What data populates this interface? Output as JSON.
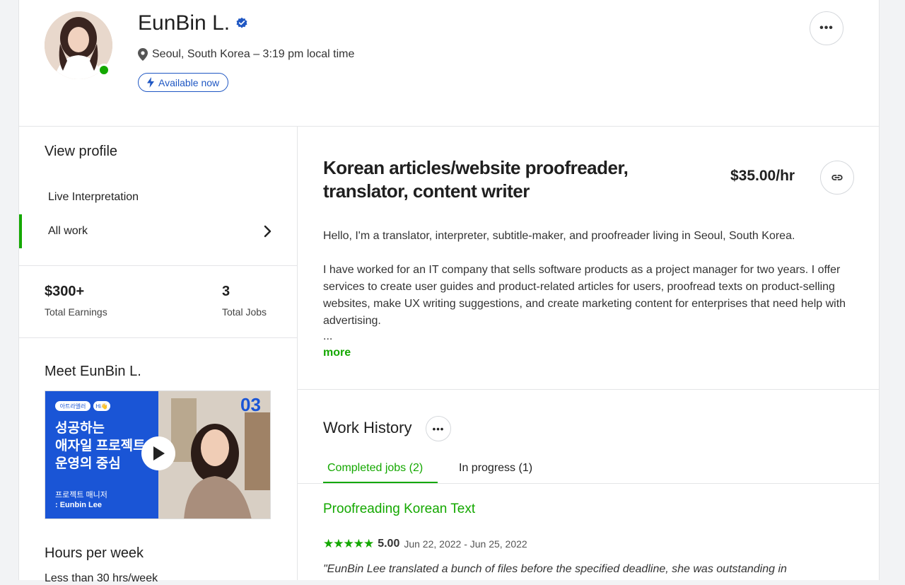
{
  "profile": {
    "name": "EunBin L.",
    "location": "Seoul, South Korea – 3:19 pm local time",
    "availability": "Available now",
    "more_label": "•••"
  },
  "sidebar": {
    "view_profile_title": "View profile",
    "items": [
      {
        "label": "Live Interpretation",
        "active": false
      },
      {
        "label": "All work",
        "active": true
      }
    ]
  },
  "stats": {
    "earnings_value": "$300+",
    "earnings_label": "Total Earnings",
    "jobs_value": "3",
    "jobs_label": "Total Jobs"
  },
  "video": {
    "title": "Meet EunBin L.",
    "badge_left": "아트라엘러",
    "badge_right": "Hi👋",
    "number": "03",
    "headline_1": "성공하는",
    "headline_2": "애자일 프로젝트",
    "headline_3": "운영의 중심",
    "subtitle_1": "프로젝트 매니저",
    "subtitle_2": ": Eunbin Lee"
  },
  "hours": {
    "title": "Hours per week",
    "value": "Less than 30 hrs/week"
  },
  "main": {
    "job_title": "Korean articles/website proofreader, translator, content writer",
    "rate": "$35.00/hr",
    "desc_1": "Hello, I'm a translator, interpreter, subtitle-maker, and proofreader living in Seoul, South Korea.",
    "desc_2": "I have worked for an IT company that sells software products as a project manager for two years. I offer services to create user guides and product-related articles for users, proofread texts on product-selling websites, make UX writing suggestions, and create marketing content for enterprises that need help with advertising.",
    "ellipsis": "...",
    "more_link": "more"
  },
  "work_history": {
    "title": "Work History",
    "more_label": "•••",
    "tabs": [
      {
        "label": "Completed jobs (2)",
        "active": true
      },
      {
        "label": "In progress (1)",
        "active": false
      }
    ],
    "job": {
      "title": "Proofreading Korean Text",
      "stars": "★★★★★",
      "rating": "5.00",
      "dates": "Jun 22, 2022 - Jun 25, 2022",
      "quote": "\"EunBin Lee translated a bunch of files before the specified deadline, she was outstanding in"
    }
  },
  "colors": {
    "accent_green": "#14a800",
    "accent_blue": "#1f57c3"
  }
}
